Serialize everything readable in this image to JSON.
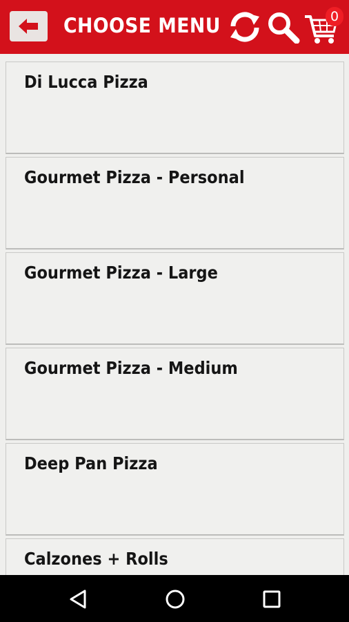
{
  "header": {
    "title": "CHOOSE MENU",
    "back_icon": "arrow-left-icon",
    "refresh_icon": "refresh-icon",
    "search_icon": "search-icon",
    "cart_icon": "shopping-cart-icon",
    "cart_count": "0",
    "colors": {
      "bar": "#d3111b",
      "badge": "#ef1e25"
    }
  },
  "menu": {
    "items": [
      {
        "label": "Di Lucca Pizza"
      },
      {
        "label": "Gourmet Pizza - Personal"
      },
      {
        "label": "Gourmet Pizza - Large"
      },
      {
        "label": "Gourmet Pizza - Medium"
      },
      {
        "label": "Deep Pan Pizza"
      },
      {
        "label": "Calzones + Rolls"
      }
    ]
  },
  "navbar": {
    "back_icon": "triangle-back-icon",
    "home_icon": "circle-home-icon",
    "recent_icon": "square-recents-icon"
  }
}
